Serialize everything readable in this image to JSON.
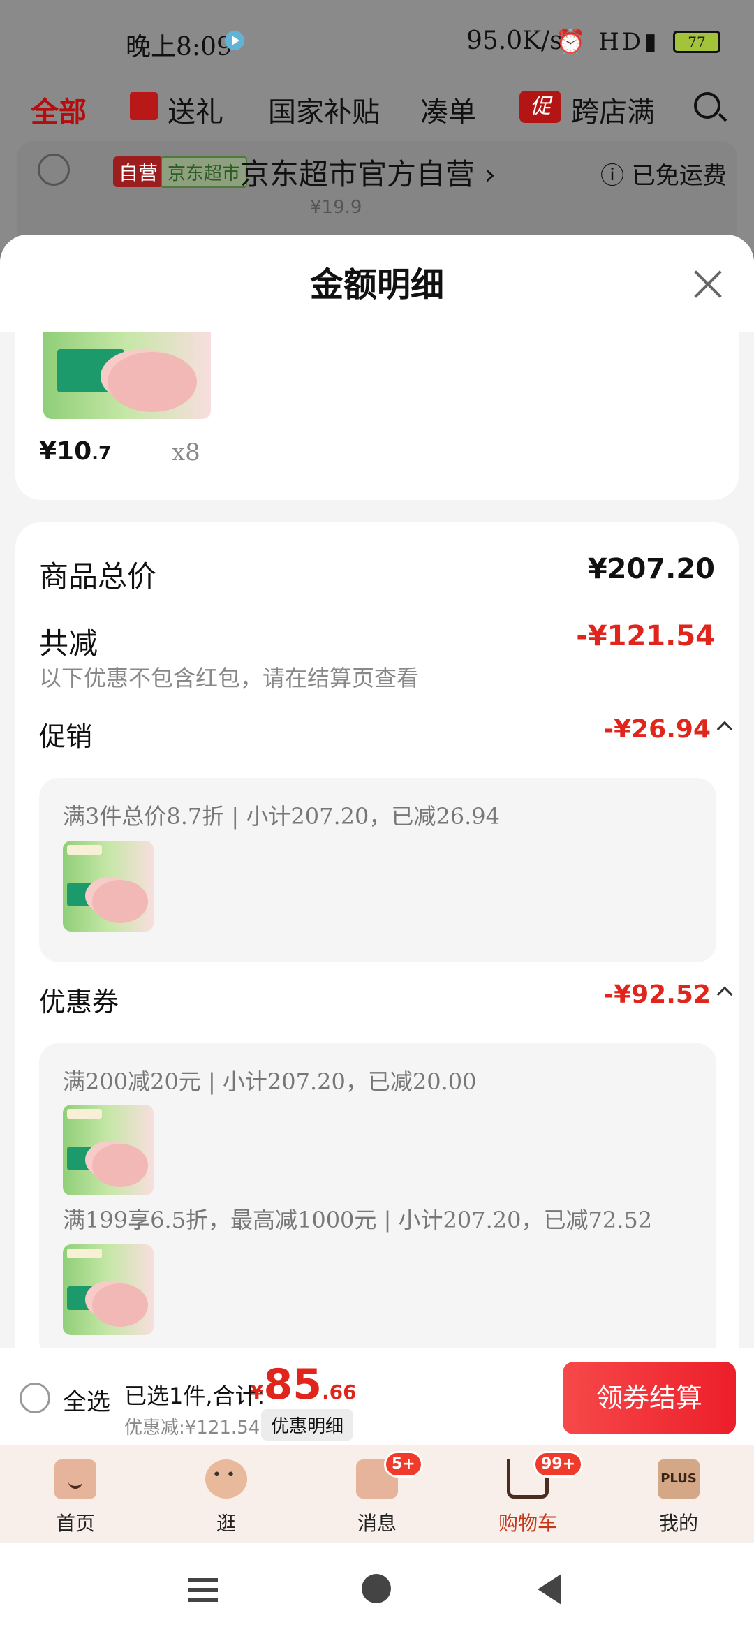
{
  "status_bar": {
    "time": "晚上8:09",
    "net_speed": "95.0K/s",
    "signal_icons": "⏰ HD▮ ⌔",
    "battery": "77"
  },
  "tabs": {
    "all": "全部",
    "gift": "送礼",
    "subsidy": "国家补贴",
    "combine": "凑单",
    "promo_icon": "促",
    "cross_store": "跨店满"
  },
  "store": {
    "self_tag": "自营",
    "jd_tag": "京东超市",
    "name": "京东超市官方自营 ›",
    "shipping": "ⓘ 已免运费",
    "strike_price": "¥19.9"
  },
  "sheet": {
    "title": "金额明细",
    "item": {
      "price_int": "¥10",
      "price_dec": ".7",
      "qty": "x8"
    },
    "total_label": "商品总价",
    "total_value": "¥207.20",
    "reduce_label": "共减",
    "reduce_value": "-¥121.54",
    "reduce_note": "以下优惠不包含红包，请在结算页查看",
    "promo_label": "促销",
    "promo_value": "-¥26.94",
    "promo_line": "满3件总价8.7折 | 小计207.20，已减26.94",
    "coupon_label": "优惠券",
    "coupon_value": "-¥92.52",
    "coupon_line1": "满200减20元 | 小计207.20，已减20.00",
    "coupon_line2": "满199享6.5折，最高减1000元 | 小计207.20，已减72.52"
  },
  "checkout": {
    "select_all": "全选",
    "selected": "已选1件,合计:",
    "yen": "¥",
    "total_int": "85",
    "total_dec": ".66",
    "discount": "优惠减:¥121.54",
    "detail_btn": "优惠明细",
    "pay_btn": "领券结算"
  },
  "tabbar": {
    "home": "首页",
    "browse": "逛",
    "messages": "消息",
    "messages_badge": "5+",
    "cart": "购物车",
    "cart_badge": "99+",
    "plus_icon": "PLUS",
    "mine": "我的"
  },
  "colors": {
    "accent_red": "#e0261c",
    "button_red": "#f74949",
    "tabbar_bg": "#f9efea"
  }
}
